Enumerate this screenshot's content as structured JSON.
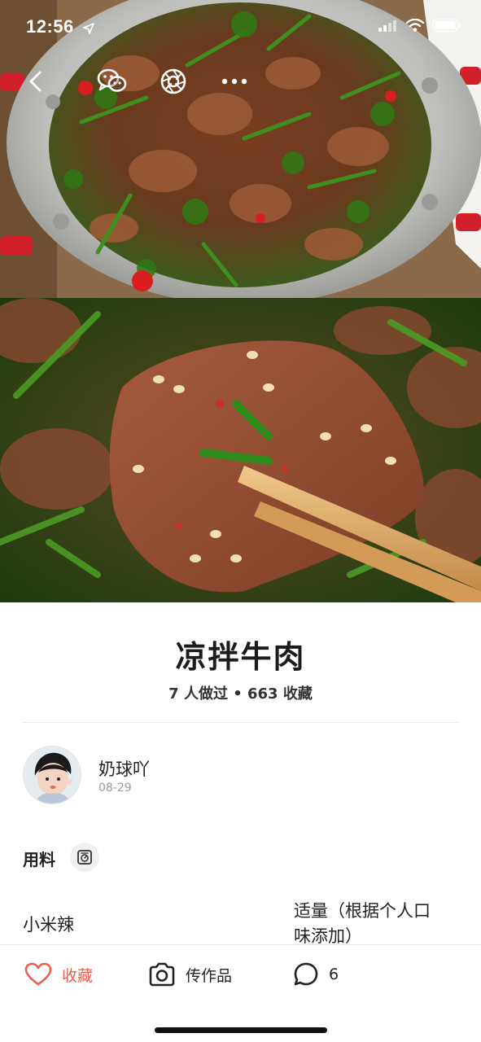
{
  "status_bar": {
    "time": "12:56"
  },
  "recipe": {
    "title": "凉拌牛肉",
    "stats": "7 人做过 • 663 收藏"
  },
  "author": {
    "name": "奶球吖",
    "date": "08-29"
  },
  "ingredients": {
    "heading": "用料",
    "items": [
      {
        "name": "小米辣",
        "amount_line1": "适量（根据个人口",
        "amount_line2": "味添加）"
      }
    ]
  },
  "actions": {
    "favorite_label": "收藏",
    "upload_label": "传作品",
    "comment_count": "6"
  },
  "colors": {
    "accent": "#e8604c",
    "text": "#222222",
    "muted": "#9a9a9a"
  },
  "icons": [
    "back-icon",
    "wechat-icon",
    "moments-icon",
    "more-icon",
    "location-arrow-icon",
    "signal-icon",
    "wifi-icon",
    "battery-icon",
    "scale-icon",
    "heart-icon",
    "camera-icon",
    "comment-icon"
  ]
}
